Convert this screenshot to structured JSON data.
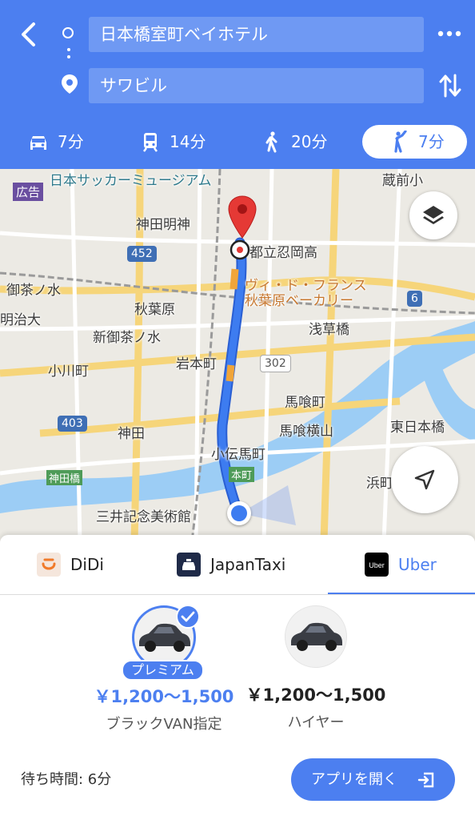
{
  "route": {
    "from": "日本橋室町ベイホテル",
    "to": "サワビル"
  },
  "modes": [
    {
      "icon": "car-icon",
      "label": "7分"
    },
    {
      "icon": "train-icon",
      "label": "14分"
    },
    {
      "icon": "walk-icon",
      "label": "20分"
    },
    {
      "icon": "ride-hail-icon",
      "label": "7分",
      "selected": true
    }
  ],
  "map": {
    "ad_label": "広告",
    "labels": {
      "soccer_museum": "日本サッカーミュージアム",
      "kanda_myojin": "神田明神",
      "school": "都立忍岡高",
      "vie_de_france_1": "ヴィ・ド・フランス",
      "vie_de_france_2": "秋葉原ベーカリー",
      "ochanomizu": "御茶ノ水",
      "meiji_univ": "明治大",
      "akihabara": "秋葉原",
      "shin_ochanomizu": "新御茶ノ水",
      "asakusabashi": "浅草橋",
      "iwamotocho": "岩本町",
      "ogawamachi": "小川町",
      "bakurocho": "馬喰町",
      "bakuro_yokoyama": "馬喰横山",
      "higashi_nihonbashi": "東日本橋",
      "kanda": "神田",
      "kodenmacho": "小伝馬町",
      "honcho": "本町",
      "kandabashi": "神田橋",
      "hamacho": "浜町",
      "mitsui_museum": "三井記念美術館",
      "kuramae": "蔵前小"
    },
    "shields": {
      "r452": "452",
      "r302": "302",
      "r403": "403",
      "r6": "6"
    }
  },
  "sheet": {
    "tabs": [
      {
        "name": "DiDi",
        "selected": false
      },
      {
        "name": "JapanTaxi",
        "selected": false
      },
      {
        "name": "Uber",
        "selected": true
      }
    ],
    "options": [
      {
        "badge": "プレミアム",
        "price": "￥1,200〜1,500",
        "name": "ブラックVAN指定",
        "selected": true
      },
      {
        "price": "￥1,200〜1,500",
        "name": "ハイヤー",
        "selected": false
      }
    ],
    "wait_time": "待ち時間: 6分",
    "open_app_label": "アプリを開く"
  },
  "colors": {
    "accent": "#4c7ff0",
    "route": "#3d7cf0",
    "pin": "#e53935"
  }
}
